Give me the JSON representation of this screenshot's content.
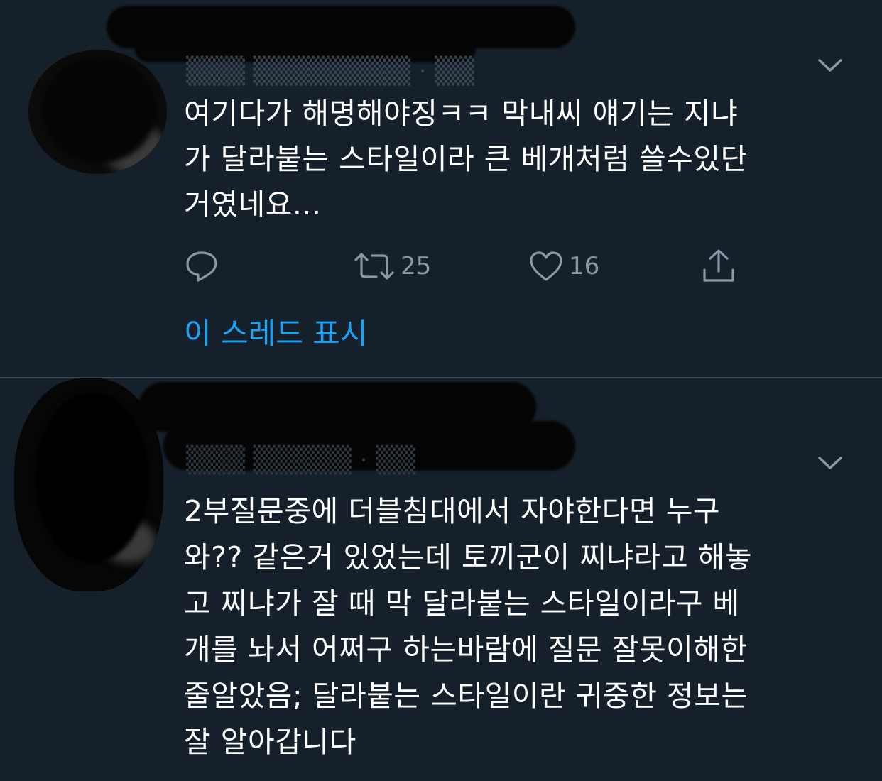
{
  "tweets": [
    {
      "body_lines": [
        "여기다가 해명해야징ㅋㅋ 막내씨 얘기는 지냐",
        "가 달라붙는 스타일이라 큰 베개처럼 쓸수있단",
        "거였네요..."
      ],
      "actions": {
        "reply_count": "",
        "retweet_count": "25",
        "like_count": "16"
      },
      "show_thread_label": "이 스레드 표시"
    },
    {
      "body_lines": [
        "2부질문중에 더블침대에서 자야한다면 누구",
        "와?? 같은거 있었는데 토끼군이 찌냐라고 해놓",
        "고 찌냐가 잘 때 막 달라붙는 스타일이라구 베",
        "개를 놔서 어쩌구 하는바람에 질문 잘못이해한",
        "줄알았음; 달라붙는 스타일이란 귀중한 정보는",
        "잘 알아갑니다"
      ]
    }
  ],
  "icons": {
    "reply": "reply-icon",
    "retweet": "retweet-icon",
    "like": "heart-icon",
    "share": "share-icon",
    "more": "chevron-down-icon"
  },
  "colors": {
    "background": "#15202b",
    "text": "#ffffff",
    "secondary": "#8899a6",
    "accent": "#1da1f2",
    "divider": "#38444d"
  }
}
